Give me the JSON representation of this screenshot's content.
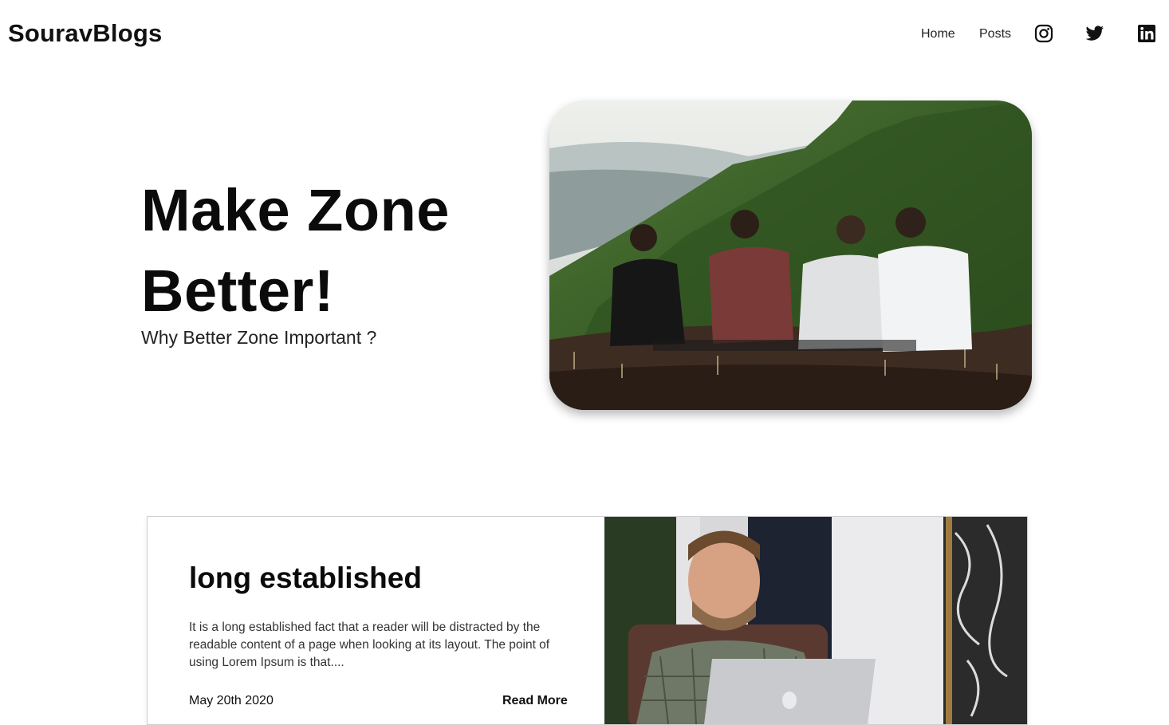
{
  "header": {
    "logo": "SouravBlogs",
    "nav": [
      "Home",
      "Posts"
    ],
    "social_icons": [
      "instagram-icon",
      "twitter-icon",
      "linkedin-icon"
    ]
  },
  "hero": {
    "title_line1": "Make Zone",
    "title_line2": "Better!",
    "subtitle": "Why Better Zone Important ?",
    "image": "four-friends-sitting-on-green-mountain-photo"
  },
  "post": {
    "title": "long established",
    "excerpt": "It is a long established fact that a reader will be distracted by the readable content of a page when looking at its layout. The point of using Lorem Ipsum is that....",
    "date": "May 20th 2020",
    "read_more": "Read More",
    "image": "man-smiling-at-laptop-photo"
  }
}
